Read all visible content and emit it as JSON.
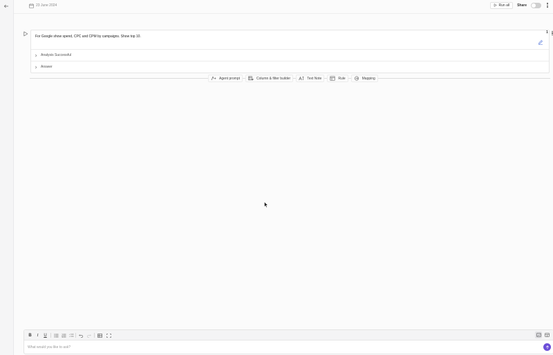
{
  "header": {
    "date": "23 June 2024",
    "run_all_label": "Run all",
    "share_label": "Share",
    "share_enabled": false
  },
  "cell": {
    "number": "1",
    "prompt": "For Google show spend, CPC and CPM by campaigns. Show top 10.",
    "sections": [
      {
        "label": "Analysis Successful"
      },
      {
        "label": "Answer"
      }
    ]
  },
  "add_bar": {
    "items": [
      {
        "label": "Agent prompt",
        "icon": "agent-prompt-icon"
      },
      {
        "label": "Column & filter builder",
        "icon": "column-filter-icon"
      },
      {
        "label": "Text Note",
        "icon": "text-note-icon"
      },
      {
        "label": "Rule",
        "icon": "rule-icon"
      },
      {
        "label": "Mapping",
        "icon": "mapping-icon"
      }
    ]
  },
  "composer": {
    "placeholder": "What would you like to ask?",
    "value": ""
  },
  "colors": {
    "accent": "#6c4fd8",
    "background": "#fbfbfb",
    "rail": "#f5f5f6"
  }
}
